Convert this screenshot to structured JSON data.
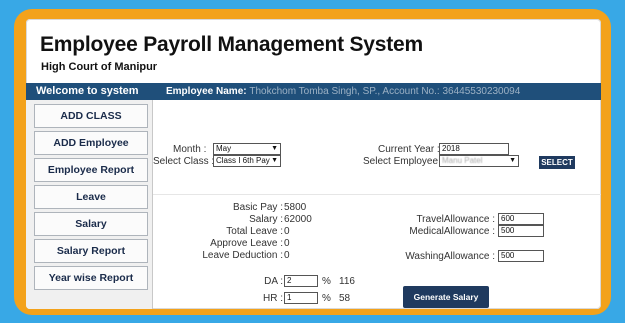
{
  "header": {
    "title": "Employee Payroll Management System",
    "subtitle": "High Court of Manipur"
  },
  "topbar": {
    "welcome": "Welcome to system",
    "employee_name_label": "Employee Name:",
    "employee_name_value": "Thokchom Tomba Singh, SP., Account No.: 36445530230094"
  },
  "sidebar": {
    "items": [
      {
        "label": "ADD CLASS"
      },
      {
        "label": "ADD Employee"
      },
      {
        "label": "Employee Report"
      },
      {
        "label": "Leave"
      },
      {
        "label": "Salary"
      },
      {
        "label": "Salary Report"
      },
      {
        "label": "Year wise Report"
      }
    ]
  },
  "form": {
    "month_label": "Month :",
    "month_value": "May",
    "current_year_label": "Current Year :",
    "current_year_value": "2018",
    "select_class_label": "Select Class :",
    "select_class_value": "Class I 6th Pay",
    "select_employee_label": "Select Employee :",
    "select_employee_value": "Manu Patel",
    "select_button": "SELECT"
  },
  "salary": {
    "basic_pay_label": "Basic Pay :",
    "basic_pay_value": "5800",
    "salary_label": "Salary :",
    "salary_value": "62000",
    "total_leave_label": "Total Leave :",
    "total_leave_value": "0",
    "approve_leave_label": "Approve Leave :",
    "approve_leave_value": "0",
    "leave_deduction_label": "Leave Deduction :",
    "leave_deduction_value": "0",
    "travel_allowance_label": "TravelAllowance :",
    "travel_allowance_value": "600",
    "medical_allowance_label": "MedicalAllowance :",
    "medical_allowance_value": "500",
    "washing_allowance_label": "WashingAllowance :",
    "washing_allowance_value": "500",
    "da_label": "DA :",
    "da_input": "2",
    "da_percent": "%",
    "da_amount": "116",
    "hr_label": "HR :",
    "hr_input": "1",
    "hr_percent": "%",
    "hr_amount": "58",
    "generate_button": "Generate Salary"
  },
  "colors": {
    "background": "#38a8e6",
    "frame": "#f3a21b",
    "topbar": "#1f4f7a",
    "button": "#1f3a5f"
  }
}
